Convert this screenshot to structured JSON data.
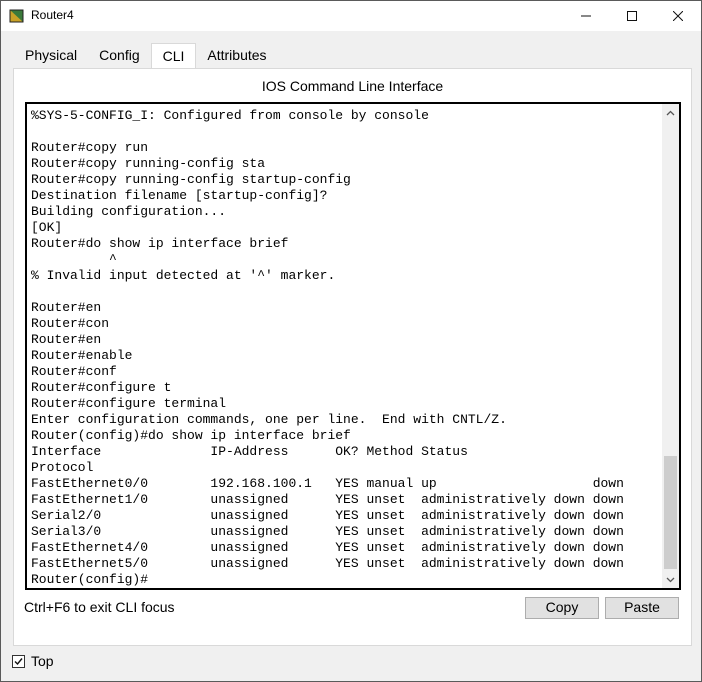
{
  "window": {
    "title": "Router4"
  },
  "tabs": [
    {
      "label": "Physical",
      "active": false
    },
    {
      "label": "Config",
      "active": false
    },
    {
      "label": "CLI",
      "active": true
    },
    {
      "label": "Attributes",
      "active": false
    }
  ],
  "cli": {
    "header": "IOS Command Line Interface",
    "lines": [
      "Router#",
      "%SYS-5-CONFIG_I: Configured from console by console",
      "",
      "Router#copy run",
      "Router#copy running-config sta",
      "Router#copy running-config startup-config",
      "Destination filename [startup-config]?",
      "Building configuration...",
      "[OK]",
      "Router#do show ip interface brief",
      "          ^",
      "% Invalid input detected at '^' marker.",
      "",
      "Router#en",
      "Router#con",
      "Router#en",
      "Router#enable",
      "Router#conf",
      "Router#configure t",
      "Router#configure terminal",
      "Enter configuration commands, one per line.  End with CNTL/Z.",
      "Router(config)#do show ip interface brief",
      "Interface              IP-Address      OK? Method Status",
      "Protocol",
      "FastEthernet0/0        192.168.100.1   YES manual up                    down",
      "FastEthernet1/0        unassigned      YES unset  administratively down down",
      "Serial2/0              unassigned      YES unset  administratively down down",
      "Serial3/0              unassigned      YES unset  administratively down down",
      "FastEthernet4/0        unassigned      YES unset  administratively down down",
      "FastEthernet5/0        unassigned      YES unset  administratively down down",
      "Router(config)#"
    ],
    "hint": "Ctrl+F6 to exit CLI focus",
    "copy_label": "Copy",
    "paste_label": "Paste"
  },
  "footer": {
    "top_label": "Top",
    "top_checked": true
  },
  "colors": {
    "accent": "#1c3f73",
    "button_bg": "#e1e1e1"
  }
}
